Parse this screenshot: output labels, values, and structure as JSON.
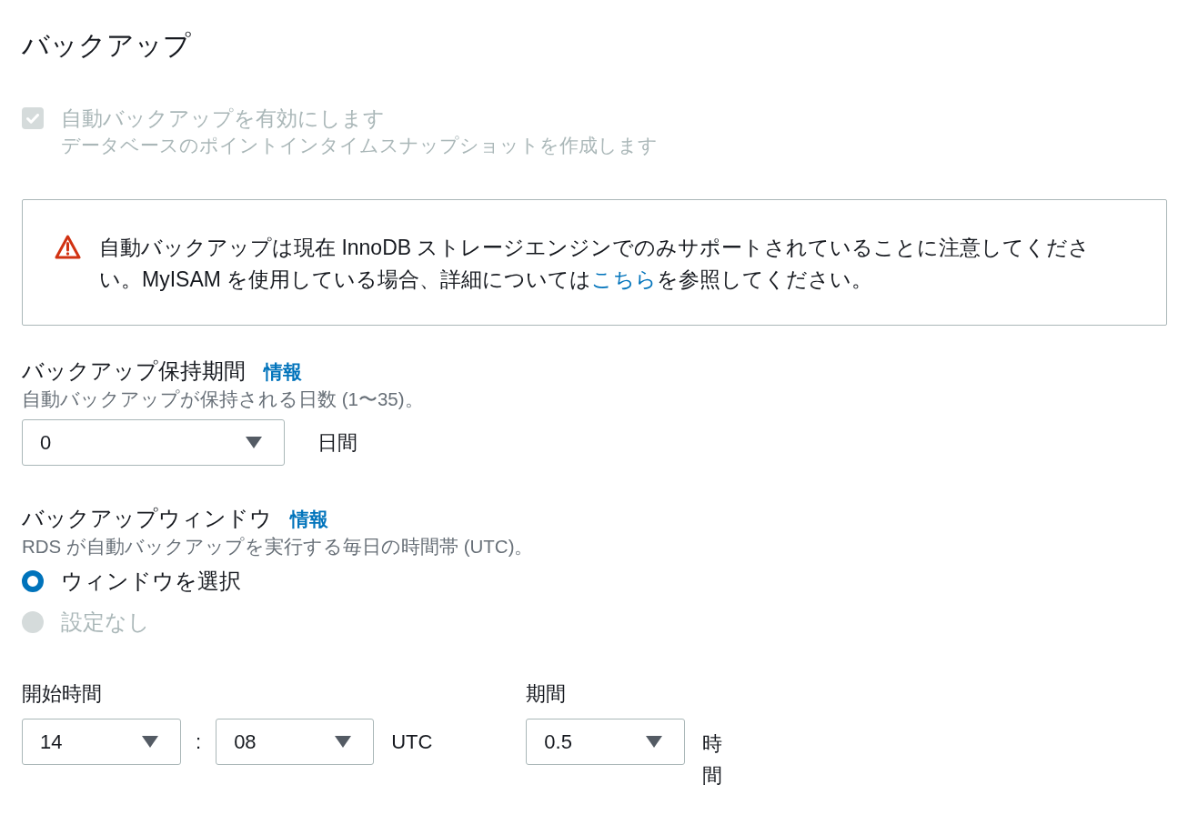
{
  "title": "バックアップ",
  "auto_backup": {
    "label": "自動バックアップを有効にします",
    "description": "データベースのポイントインタイムスナップショットを作成します",
    "checked": true,
    "disabled": true
  },
  "alert": {
    "text": "自動バックアップは現在 InnoDB ストレージエンジンでのみサポートされていることに注意してください。MyISAM を使用している場合、詳細については",
    "link": "こちら",
    "text_after": "を参照してください。"
  },
  "retention": {
    "label": "バックアップ保持期間",
    "info": "情報",
    "hint": "自動バックアップが保持される日数 (1〜35)。",
    "value": "0",
    "unit": "日間"
  },
  "backup_window": {
    "label": "バックアップウィンドウ",
    "info": "情報",
    "hint": "RDS が自動バックアップを実行する毎日の時間帯 (UTC)。",
    "options": [
      {
        "label": "ウィンドウを選択",
        "selected": true,
        "disabled": false
      },
      {
        "label": "設定なし",
        "selected": false,
        "disabled": true
      }
    ]
  },
  "start_time": {
    "label": "開始時間",
    "hour": "14",
    "separator": ":",
    "minute": "08",
    "timezone": "UTC"
  },
  "duration": {
    "label": "期間",
    "value": "0.5",
    "unit": "時間"
  }
}
